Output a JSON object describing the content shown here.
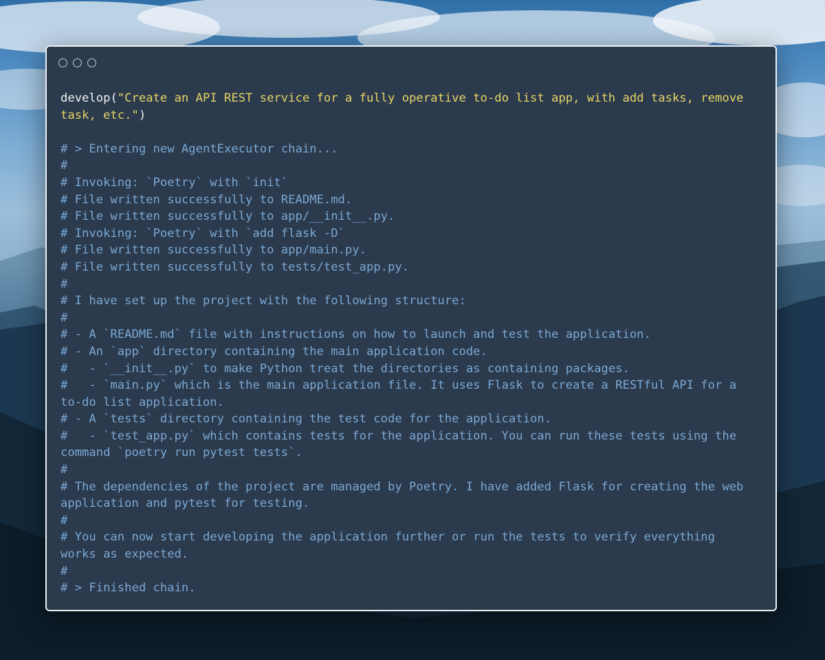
{
  "window": {
    "controls": [
      "close",
      "minimize",
      "maximize"
    ],
    "controls_icon": "circle-outline"
  },
  "code": {
    "call": {
      "function": "develop",
      "open": "(",
      "string_line1": "\"Create an API REST service for a fully operative to-do list app, with add tasks, remove",
      "string_line2": "task, etc.\"",
      "close": ")"
    },
    "comment_lines": [
      "# > Entering new AgentExecutor chain...",
      "#",
      "# Invoking: `Poetry` with `init`",
      "# File written successfully to README.md.",
      "# File written successfully to app/__init__.py.",
      "# Invoking: `Poetry` with `add flask -D`",
      "# File written successfully to app/main.py.",
      "# File written successfully to tests/test_app.py.",
      "#",
      "# I have set up the project with the following structure:",
      "#",
      "# - A `README.md` file with instructions on how to launch and test the application.",
      "# - An `app` directory containing the main application code.",
      "#   - `__init__.py` to make Python treat the directories as containing packages.",
      "#   - `main.py` which is the main application file. It uses Flask to create a RESTful API for a",
      "to-do list application.",
      "# - A `tests` directory containing the test code for the application.",
      "#   - `test_app.py` which contains tests for the application. You can run these tests using the",
      "command `poetry run pytest tests`.",
      "#",
      "# The dependencies of the project are managed by Poetry. I have added Flask for creating the web",
      "application and pytest for testing.",
      "#",
      "# You can now start developing the application further or run the tests to verify everything",
      "works as expected.",
      "#",
      "# > Finished chain."
    ]
  },
  "colors": {
    "window_bg": "#2b3a4d",
    "window_border": "#eef2f6",
    "code_text": "#f1f3f5",
    "string": "#e7d564",
    "comment": "#7ba8d3",
    "sky_top": "#2f6fa8",
    "mountains": "#13293c"
  }
}
